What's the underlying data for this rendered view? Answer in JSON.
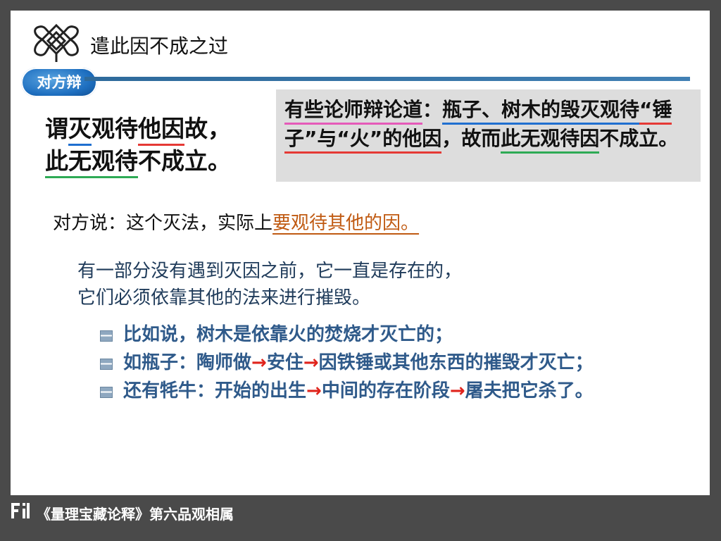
{
  "header": {
    "title": "遣此因不成之过",
    "badge": "对方辩"
  },
  "claim": {
    "line1": [
      "谓",
      "灭",
      "观待",
      "他因",
      "故，"
    ],
    "line2": [
      "此无观待",
      "不成立。"
    ]
  },
  "opponent_box": {
    "parts": [
      "有些论师辩论道",
      "：",
      "瓶子、树木的毁灭观待",
      "“锤子”与“火”的他因",
      "，故而",
      "此无观待因",
      "不成立。"
    ]
  },
  "speech": {
    "label": "对方说：",
    "text": "这个灭法，实际上",
    "highlight": "要观待其他的因。"
  },
  "explanation": {
    "line1": "有一部分没有遇到灭因之前，它一直是存在的，",
    "line2": "它们必须依靠其他的法来进行摧毁。"
  },
  "bullets": {
    "item1": "比如说，树木是依靠火的焚烧才灭亡的；",
    "item2_a": "如瓶子：陶师做",
    "item2_b": "安住",
    "item2_c": "因铁锤或其他东西的摧毁才灭亡；",
    "item3_a": "还有牦牛：开始的出生",
    "item3_b": "中间的存在阶段",
    "item3_c": "屠夫把它杀了。",
    "arrow": "→"
  },
  "footer": {
    "text": "《量理宝藏论释》第六品观相属"
  },
  "colors": {
    "background": "#4a4a4a",
    "accent_blue": "#2e6a9b",
    "bullet_text": "#2f5a8a",
    "arrow_red": "#e0241c",
    "highlight_orange": "#c05a12"
  }
}
